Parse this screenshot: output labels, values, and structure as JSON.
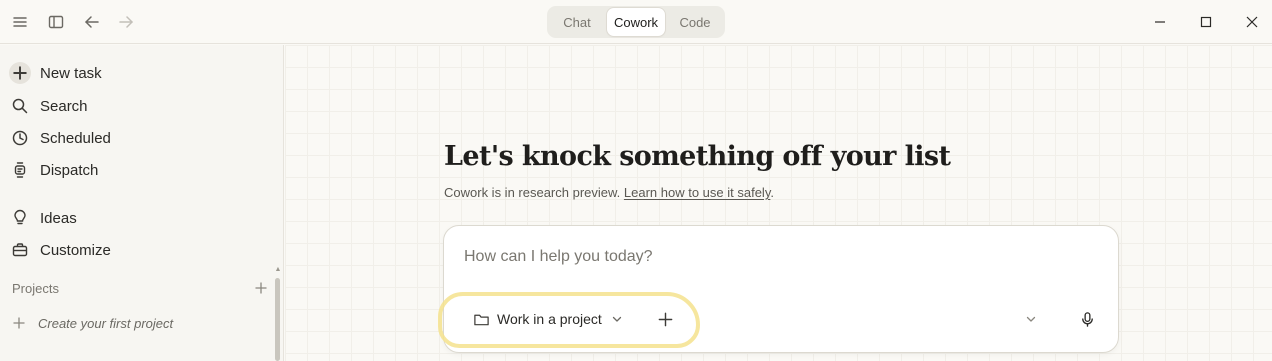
{
  "titlebar": {
    "menu_icon": "hamburger-menu-icon",
    "sidebar_toggle_icon": "sidebar-panel-icon",
    "back_icon": "arrow-left-icon",
    "forward_icon": "arrow-right-icon",
    "modes": [
      {
        "label": "Chat",
        "active": false
      },
      {
        "label": "Cowork",
        "active": true
      },
      {
        "label": "Code",
        "active": false
      }
    ],
    "window_controls": [
      "minimize-icon",
      "maximize-icon",
      "close-icon"
    ]
  },
  "sidebar": {
    "items": [
      {
        "label": "New task",
        "icon": "plus-circle-icon"
      },
      {
        "label": "Search",
        "icon": "search-icon"
      },
      {
        "label": "Scheduled",
        "icon": "clock-icon"
      },
      {
        "label": "Dispatch",
        "icon": "watch-icon"
      },
      {
        "label": "Ideas",
        "icon": "lightbulb-icon"
      },
      {
        "label": "Customize",
        "icon": "briefcase-icon"
      }
    ],
    "projects": {
      "heading": "Projects",
      "empty_label": "Create your first project"
    }
  },
  "main": {
    "headline": "Let's knock something off your list",
    "subtitle_text": "Cowork is in research preview. ",
    "subtitle_link": "Learn how to use it safely",
    "subtitle_end": ".",
    "composer": {
      "placeholder": "How can I help you today?",
      "project_button": "Work in a project",
      "highlight_color": "#f5e28d"
    }
  }
}
